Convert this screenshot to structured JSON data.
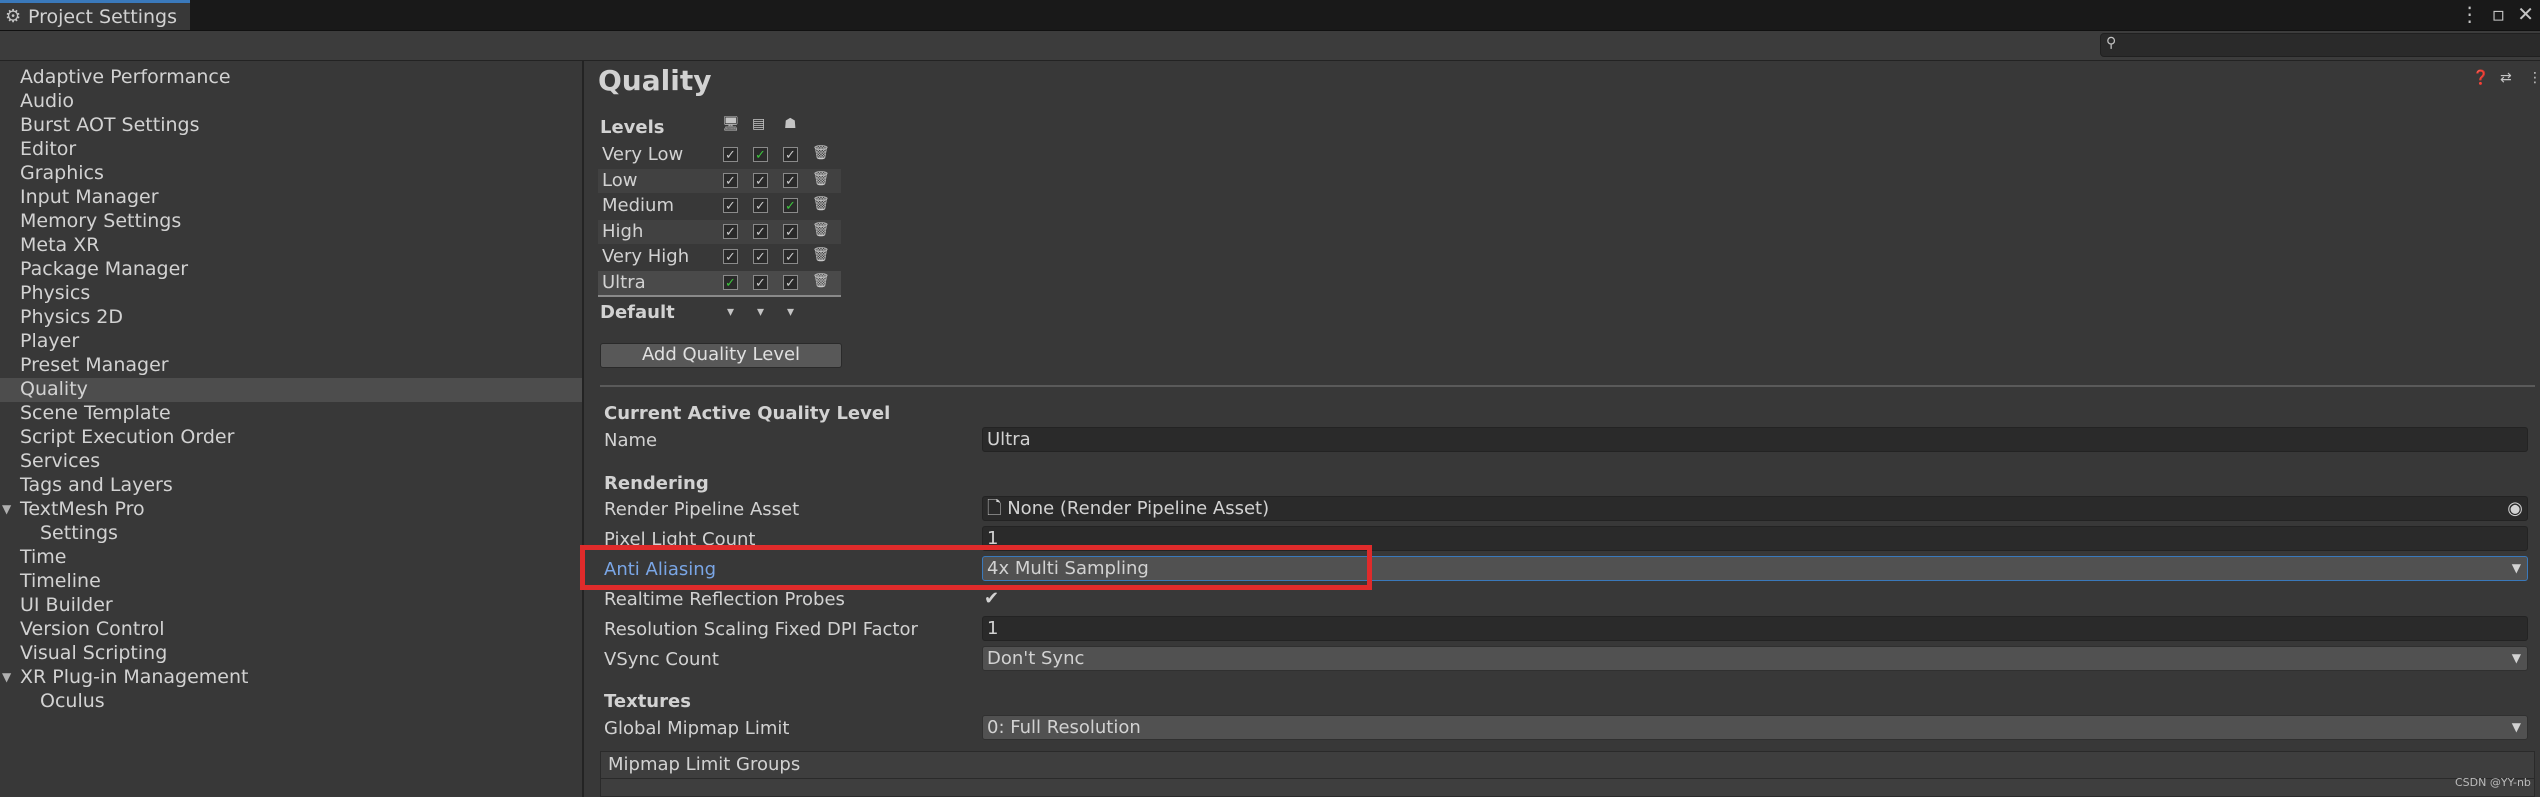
{
  "window": {
    "title": "Project Settings"
  },
  "sidebar": {
    "items": [
      {
        "label": "Adaptive Performance"
      },
      {
        "label": "Audio"
      },
      {
        "label": "Burst AOT Settings"
      },
      {
        "label": "Editor"
      },
      {
        "label": "Graphics"
      },
      {
        "label": "Input Manager"
      },
      {
        "label": "Memory Settings"
      },
      {
        "label": "Meta XR"
      },
      {
        "label": "Package Manager"
      },
      {
        "label": "Physics"
      },
      {
        "label": "Physics 2D"
      },
      {
        "label": "Player"
      },
      {
        "label": "Preset Manager"
      },
      {
        "label": "Quality",
        "selected": true
      },
      {
        "label": "Scene Template"
      },
      {
        "label": "Script Execution Order"
      },
      {
        "label": "Services"
      },
      {
        "label": "Tags and Layers"
      },
      {
        "label": "TextMesh Pro",
        "expanded": true
      },
      {
        "label": "Settings",
        "child": true
      },
      {
        "label": "Time"
      },
      {
        "label": "Timeline"
      },
      {
        "label": "UI Builder"
      },
      {
        "label": "Version Control"
      },
      {
        "label": "Visual Scripting"
      },
      {
        "label": "XR Plug-in Management",
        "expanded": true
      },
      {
        "label": "Oculus",
        "child": true
      }
    ]
  },
  "main": {
    "title": "Quality",
    "levels": {
      "header": "Levels",
      "platform_icons": [
        "desktop-icon",
        "server-icon",
        "android-icon"
      ],
      "rows": [
        {
          "name": "Very Low",
          "green": [
            false,
            true,
            false
          ]
        },
        {
          "name": "Low",
          "green": [
            false,
            false,
            false
          ]
        },
        {
          "name": "Medium",
          "green": [
            false,
            false,
            true
          ]
        },
        {
          "name": "High",
          "green": [
            false,
            false,
            false
          ]
        },
        {
          "name": "Very High",
          "green": [
            false,
            false,
            false
          ]
        },
        {
          "name": "Ultra",
          "green": [
            true,
            false,
            false
          ]
        }
      ],
      "default_label": "Default",
      "add_button": "Add Quality Level"
    },
    "current": {
      "header": "Current Active Quality Level",
      "name_label": "Name",
      "name_value": "Ultra"
    },
    "rendering": {
      "header": "Rendering",
      "rpa_label": "Render Pipeline Asset",
      "rpa_value": "None (Render Pipeline Asset)",
      "plc_label": "Pixel Light Count",
      "plc_value": "1",
      "aa_label": "Anti Aliasing",
      "aa_value": "4x Multi Sampling",
      "rrp_label": "Realtime Reflection Probes",
      "rrp_checked": true,
      "rsf_label": "Resolution Scaling Fixed DPI Factor",
      "rsf_value": "1",
      "vsync_label": "VSync Count",
      "vsync_value": "Don't Sync"
    },
    "textures": {
      "header": "Textures",
      "gml_label": "Global Mipmap Limit",
      "gml_value": "0: Full Resolution",
      "mlg_label": "Mipmap Limit Groups"
    },
    "watermark": "CSDN @YY-nb"
  },
  "colors": {
    "accent": "#3a79bb",
    "highlight": "#e02b2b",
    "label_active": "#7aa6e6",
    "check_green": "#3cc43c"
  }
}
